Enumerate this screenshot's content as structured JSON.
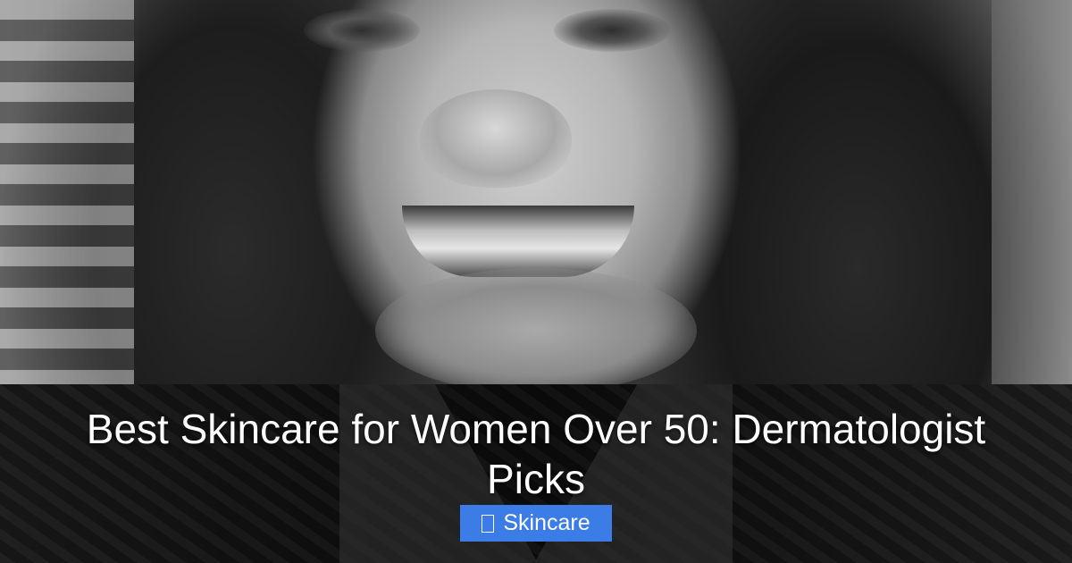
{
  "headline": {
    "title": "Best Skincare for Women Over 50: Dermatologist Picks"
  },
  "category_badge": {
    "label": "Skincare",
    "icon": "tag-icon",
    "color": "#3b7ce6"
  },
  "overlay": {
    "color": "#000000",
    "opacity": 0.55
  }
}
